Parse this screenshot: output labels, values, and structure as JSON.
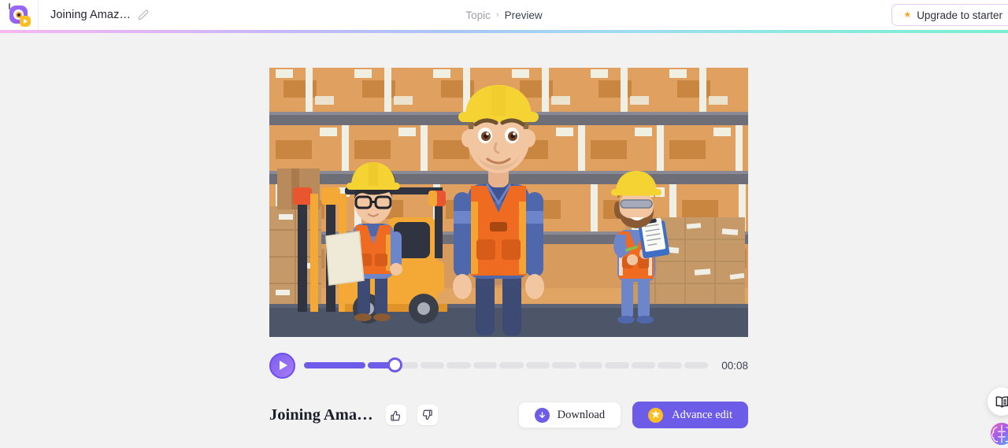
{
  "header": {
    "logo_name": "app-logo",
    "doc_title": "Joining Amaz…",
    "edit_icon": "pencil-icon",
    "breadcrumb": {
      "parent": "Topic",
      "separator": "›",
      "current": "Preview"
    },
    "upgrade": {
      "label": "Upgrade to starter",
      "icon": "star-icon",
      "star": "★"
    }
  },
  "player": {
    "play_icon": "play-icon",
    "time": "00:08",
    "segments_total": 14,
    "segments_filled": 2,
    "progress_percent": 18
  },
  "video": {
    "name": "warehouse-training-video",
    "alt": "Cartoon warehouse scene with three workers in yellow hard hats and orange safety vests, a forklift, and stacked cardboard boxes on shelves"
  },
  "bottom": {
    "title": "Joining Ama…",
    "like_icon": "thumbs-up-icon",
    "dislike_icon": "thumbs-down-icon",
    "download_label": "Download",
    "download_icon": "download-arrow-icon",
    "advance_label": "Advance edit",
    "advance_icon": "star-icon",
    "advance_star": "★"
  },
  "floating": {
    "docs_icon": "book-icon",
    "brain_icon": "brain-icon"
  },
  "colors": {
    "accent": "#6c5ce7",
    "star": "#fbbf24",
    "page_bg": "#f2f2f2",
    "header_bg": "#ffffff",
    "track_empty": "#e2e2e4"
  }
}
